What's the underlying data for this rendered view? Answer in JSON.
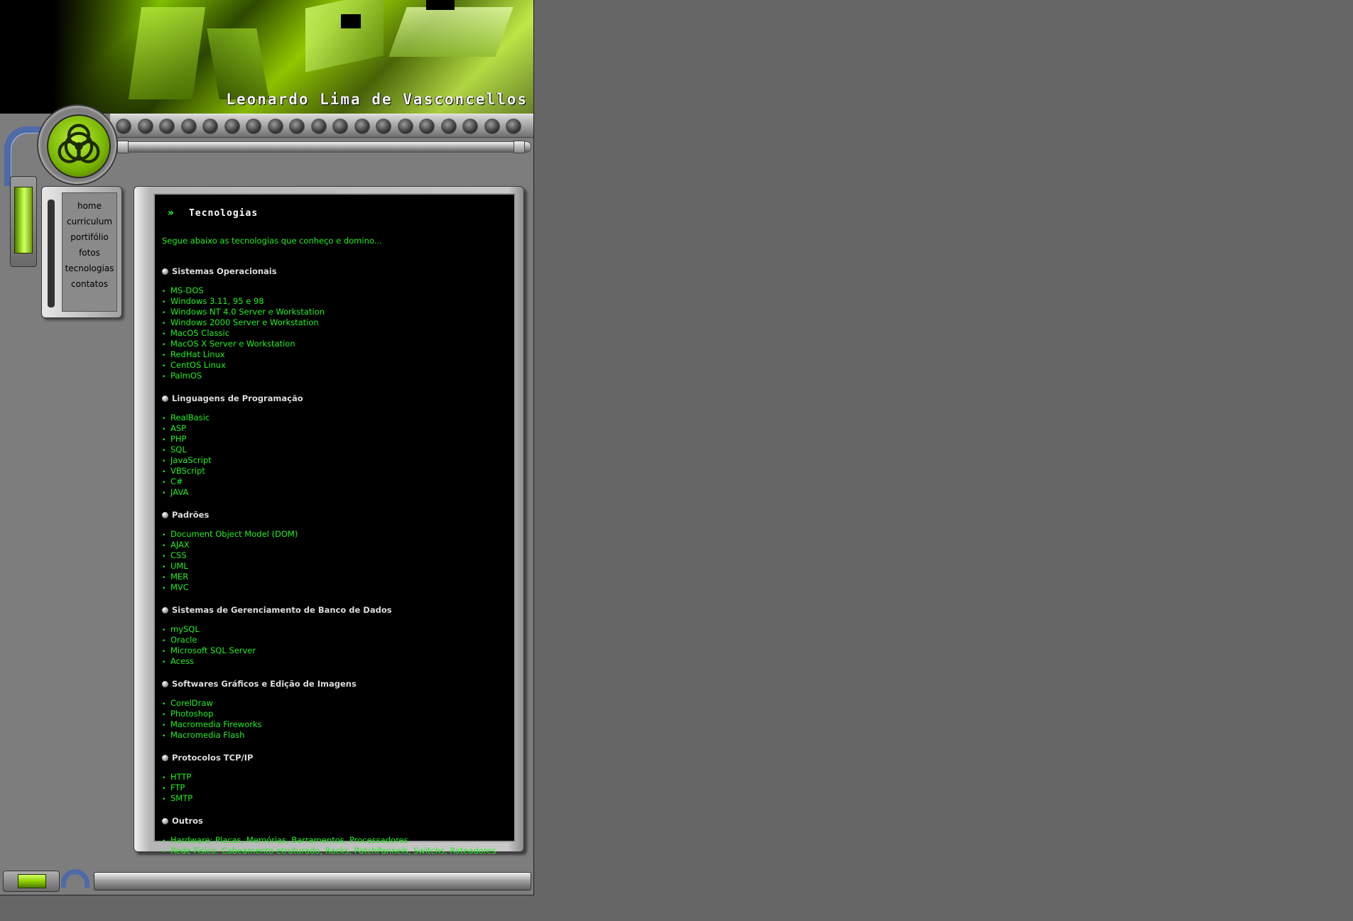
{
  "header": {
    "site_title": "Leonardo Lima de Vasconcellos"
  },
  "nav": {
    "items": [
      {
        "label": "home"
      },
      {
        "label": "curriculum"
      },
      {
        "label": "portifólio"
      },
      {
        "label": "fotos"
      },
      {
        "label": "tecnologias"
      },
      {
        "label": "contatos"
      }
    ]
  },
  "content": {
    "heading": "Tecnologias",
    "heading_arrow": "»",
    "intro": "Segue abaixo as tecnologias que conheço e domino...",
    "sections": [
      {
        "title": "Sistemas Operacionais",
        "items": [
          "MS-DOS",
          "Windows 3.11, 95 e 98",
          "Windows NT 4.0 Server e Workstation",
          "Windows 2000 Server e Workstation",
          "MacOS Classic",
          "MacOS X Server e Workstation",
          "RedHat Linux",
          "CentOS Linux",
          "PalmOS"
        ]
      },
      {
        "title": "Linguagens de Programação",
        "items": [
          "RealBasic",
          "ASP",
          "PHP",
          "SQL",
          "JavaScript",
          "VBScript",
          "C#",
          "JAVA"
        ]
      },
      {
        "title": "Padrões",
        "items": [
          "Document Object Model (DOM)",
          "AJAX",
          "CSS",
          "UML",
          "MER",
          "MVC"
        ]
      },
      {
        "title": "Sistemas de Gerenciamento de Banco de Dados",
        "items": [
          "mySQL",
          "Oracle",
          "Microsoft SQL Server",
          "Acess"
        ]
      },
      {
        "title": "Softwares Gráficos e Edição de Imagens",
        "items": [
          "CorelDraw",
          "Photoshop",
          "Macromedia Fireworks",
          "Macromedia Flash"
        ]
      },
      {
        "title": "Protocolos TCP/IP",
        "items": [
          "HTTP",
          "FTP",
          "SMTP"
        ]
      },
      {
        "title": "Outros",
        "items": [
          "Hardware: Placas, Memórias, Barramentos, Processadores",
          "Rede Fisico: Cabeamento etruturado, Racks, PatchPannels, Switchs, Roteadores"
        ]
      }
    ]
  },
  "colors": {
    "page_background": "#666666",
    "site_background": "#7d7d7d",
    "content_background": "#000000",
    "accent_green": "#22ee22",
    "section_title": "#dcdcdc",
    "hose_blue": "#4e6aa8"
  },
  "icons": {
    "hub": "biohazard-icon",
    "section_bullet": "orb-icon",
    "heading_arrow": "double-chevron-icon"
  }
}
